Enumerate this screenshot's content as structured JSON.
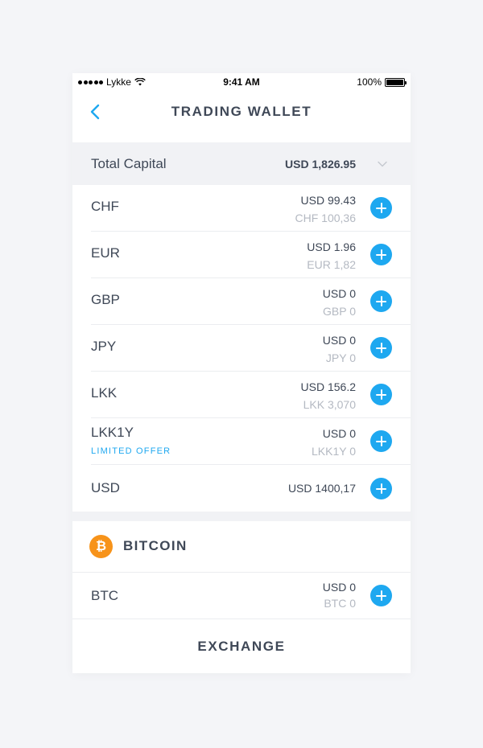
{
  "status_bar": {
    "carrier": "Lykke",
    "time": "9:41 AM",
    "battery": "100%"
  },
  "header": {
    "title": "TRADING WALLET",
    "back_icon": "chevron-left-icon"
  },
  "total": {
    "label": "Total Capital",
    "value": "USD 1,826.95",
    "icon": "chevron-down-icon"
  },
  "assets": [
    {
      "name": "CHF",
      "usd": "USD 99.43",
      "local": "CHF 100,36"
    },
    {
      "name": "EUR",
      "usd": "USD 1.96",
      "local": "EUR 1,82"
    },
    {
      "name": "GBP",
      "usd": "USD 0",
      "local": "GBP 0"
    },
    {
      "name": "JPY",
      "usd": "USD 0",
      "local": "JPY 0"
    },
    {
      "name": "LKK",
      "usd": "USD 156.2",
      "local": "LKK 3,070"
    },
    {
      "name": "LKK1Y",
      "sub_label": "LIMITED OFFER",
      "usd": "USD 0",
      "local": "LKK1Y 0"
    },
    {
      "name": "USD",
      "usd": "USD 1400,17"
    }
  ],
  "bitcoin_section": {
    "title": "BITCOIN",
    "icon": "bitcoin-icon",
    "icon_glyph": "₿",
    "assets": [
      {
        "name": "BTC",
        "usd": "USD 0",
        "local": "BTC 0"
      }
    ]
  },
  "footer": {
    "exchange_label": "EXCHANGE"
  },
  "colors": {
    "accent": "#1ea8f0",
    "bitcoin": "#f7931a",
    "text": "#3f4857",
    "muted": "#b4b9c2"
  }
}
